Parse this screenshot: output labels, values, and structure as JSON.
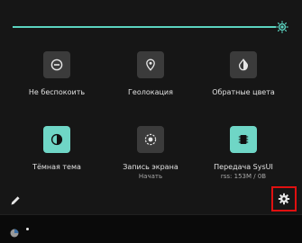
{
  "brightness": {
    "level": 1.0,
    "accent": "#5bd3c0"
  },
  "tiles": [
    {
      "id": "dnd",
      "label": "Не беспокоить",
      "sublabel": "",
      "icon": "minus-circle-icon",
      "active": false
    },
    {
      "id": "location",
      "label": "Геолокация",
      "sublabel": "",
      "icon": "location-pin-icon",
      "active": false
    },
    {
      "id": "invert",
      "label": "Обратные цвета",
      "sublabel": "",
      "icon": "invert-colors-icon",
      "active": false
    },
    {
      "id": "dark",
      "label": "Тёмная тема",
      "sublabel": "",
      "icon": "dark-theme-icon",
      "active": true
    },
    {
      "id": "record",
      "label": "Запись экрана",
      "sublabel": "Начать",
      "icon": "screen-record-icon",
      "active": false
    },
    {
      "id": "sysui",
      "label": "Передача SysUI",
      "sublabel": "rss: 153M / 0B",
      "icon": "memory-chip-icon",
      "active": true
    }
  ],
  "footer": {
    "edit_icon": "pencil-icon",
    "settings_icon": "gear-icon",
    "settings_highlight": "#e01010"
  },
  "statusbar": {
    "app_icon": "app-notification-icon"
  }
}
